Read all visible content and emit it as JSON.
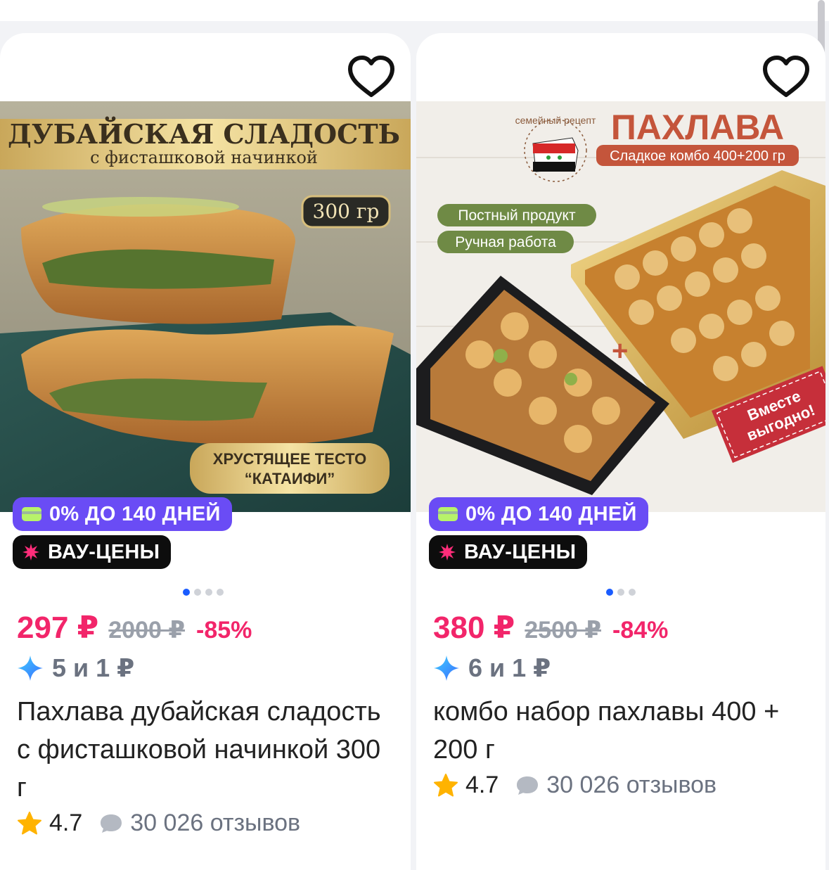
{
  "products": [
    {
      "image_text": {
        "headline": "ДУБАЙСКАЯ СЛАДОСТЬ",
        "subline": "с фисташковой начинкой",
        "weight": "300 гр",
        "tag_line1": "ХРУСТЯЩЕЕ ТЕСТО",
        "tag_line2": "“КАТАИФИ”"
      },
      "badge_installment": "0% ДО 140 ДНЕЙ",
      "badge_promo": "ВАУ-ЦЕНЫ",
      "price": "297 ₽",
      "old_price": "2000 ₽",
      "discount": "-85%",
      "bonus": "5 и 1 ₽",
      "title": "Пахлава дубайская сладость с фисташковой начинкой 300 г",
      "rating": "4.7",
      "reviews": "30 026 отзывов"
    },
    {
      "image_text": {
        "headline": "ПАХЛАВА",
        "ribbon": "Сладкое комбо 400+200 гр",
        "stamp": "семейный рецепт",
        "chip1": "Постный продукт",
        "chip2": "Ручная работа",
        "corner1": "Вместе",
        "corner2": "выгодно!"
      },
      "badge_installment": "0% ДО 140 ДНЕЙ",
      "badge_promo": "ВАУ-ЦЕНЫ",
      "price": "380 ₽",
      "old_price": "2500 ₽",
      "discount": "-84%",
      "bonus": "6 и 1 ₽",
      "title": "комбо набор пахлавы 400 + 200 г",
      "rating": "4.7",
      "reviews": "30 026 отзывов"
    }
  ],
  "colors": {
    "price": "#f2256a",
    "installment_badge": "#6a4cf5",
    "promo_badge": "#0d0d0d",
    "star": "#ffb300"
  },
  "icons": [
    "heart-icon",
    "card-icon",
    "splash-icon",
    "sparkle-icon",
    "star-icon",
    "comment-icon"
  ]
}
